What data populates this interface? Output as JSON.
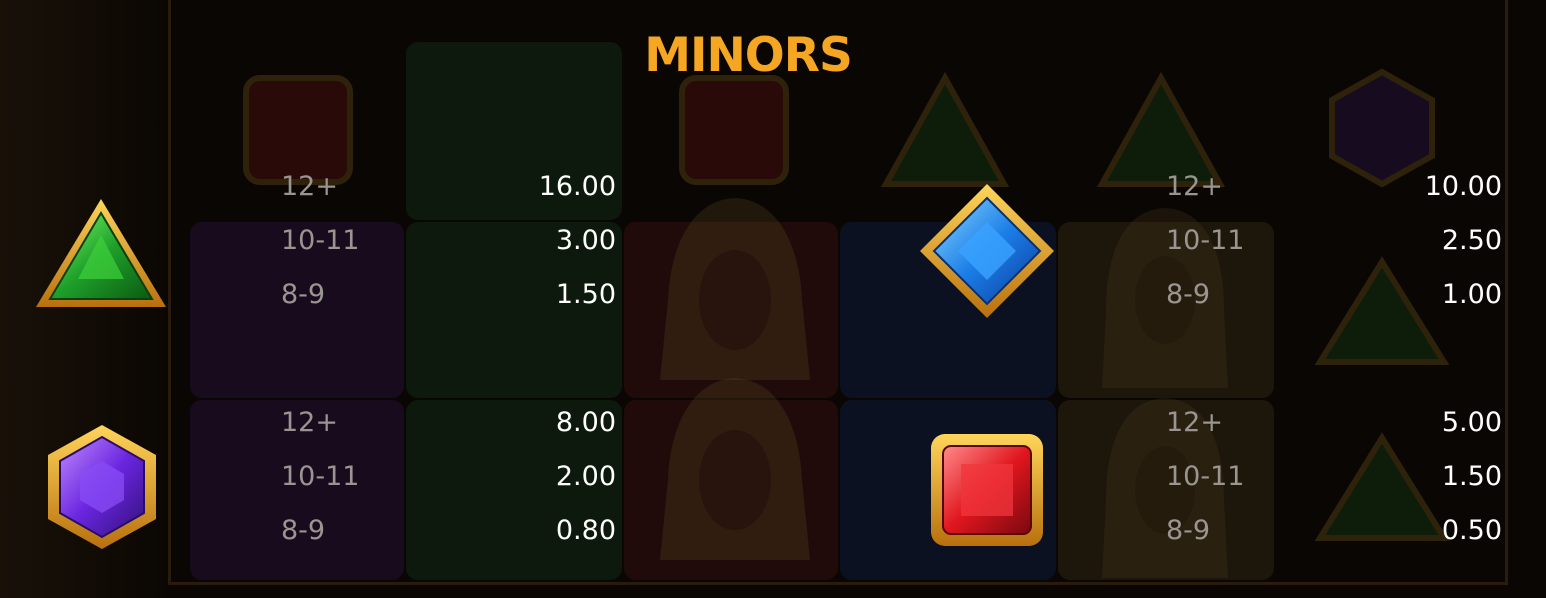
{
  "title": "MINORS",
  "colors": {
    "title": "#f5a623",
    "count_text": "#9a9590",
    "payout_text": "#ffffff"
  },
  "symbols": [
    {
      "icon": "green-triangle-gem-icon",
      "rows": [
        {
          "count": "12+",
          "payout": "16.00"
        },
        {
          "count": "10-11",
          "payout": "3.00"
        },
        {
          "count": "8-9",
          "payout": "1.50"
        }
      ]
    },
    {
      "icon": "blue-diamond-gem-icon",
      "rows": [
        {
          "count": "12+",
          "payout": "10.00"
        },
        {
          "count": "10-11",
          "payout": "2.50"
        },
        {
          "count": "8-9",
          "payout": "1.00"
        }
      ]
    },
    {
      "icon": "purple-hexagon-gem-icon",
      "rows": [
        {
          "count": "12+",
          "payout": "8.00"
        },
        {
          "count": "10-11",
          "payout": "2.00"
        },
        {
          "count": "8-9",
          "payout": "0.80"
        }
      ]
    },
    {
      "icon": "red-square-gem-icon",
      "rows": [
        {
          "count": "12+",
          "payout": "5.00"
        },
        {
          "count": "10-11",
          "payout": "1.50"
        },
        {
          "count": "8-9",
          "payout": "0.50"
        }
      ]
    }
  ]
}
